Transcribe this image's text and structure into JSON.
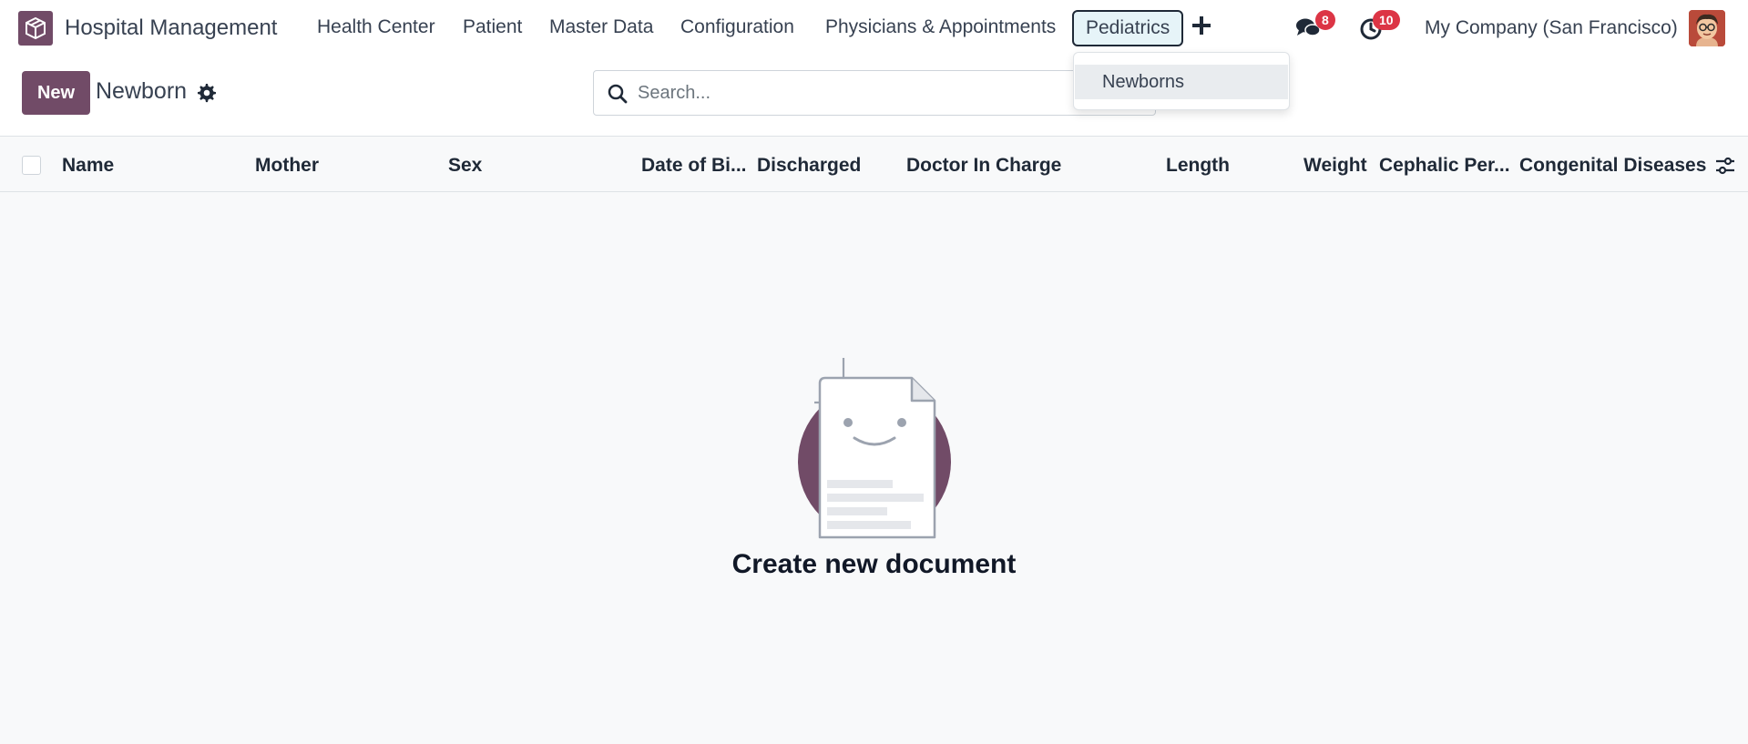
{
  "navbar": {
    "app_name": "Hospital Management",
    "menu": [
      {
        "label": "Health Center"
      },
      {
        "label": "Patient"
      },
      {
        "label": "Master Data"
      },
      {
        "label": "Configuration"
      },
      {
        "label": "Physicians & Appointments"
      },
      {
        "label": "Pediatrics"
      }
    ],
    "messages_count": "8",
    "activities_count": "10",
    "company": "My Company (San Francisco)"
  },
  "dropdown": {
    "items": [
      {
        "label": "Newborns"
      }
    ]
  },
  "control": {
    "new_label": "New",
    "title": "Newborn",
    "search_placeholder": "Search..."
  },
  "table": {
    "columns": [
      {
        "label": "Name"
      },
      {
        "label": "Mother"
      },
      {
        "label": "Sex"
      },
      {
        "label": "Date of Bi..."
      },
      {
        "label": "Discharged"
      },
      {
        "label": "Doctor In Charge"
      },
      {
        "label": "Length"
      },
      {
        "label": "Weight"
      },
      {
        "label": "Cephalic Per..."
      },
      {
        "label": "Congenital Diseases"
      }
    ]
  },
  "empty_state": {
    "title": "Create new document"
  },
  "colors": {
    "brand": "#714B67",
    "badge": "#dc3545",
    "active_menu_bg": "#e6f4f8"
  }
}
